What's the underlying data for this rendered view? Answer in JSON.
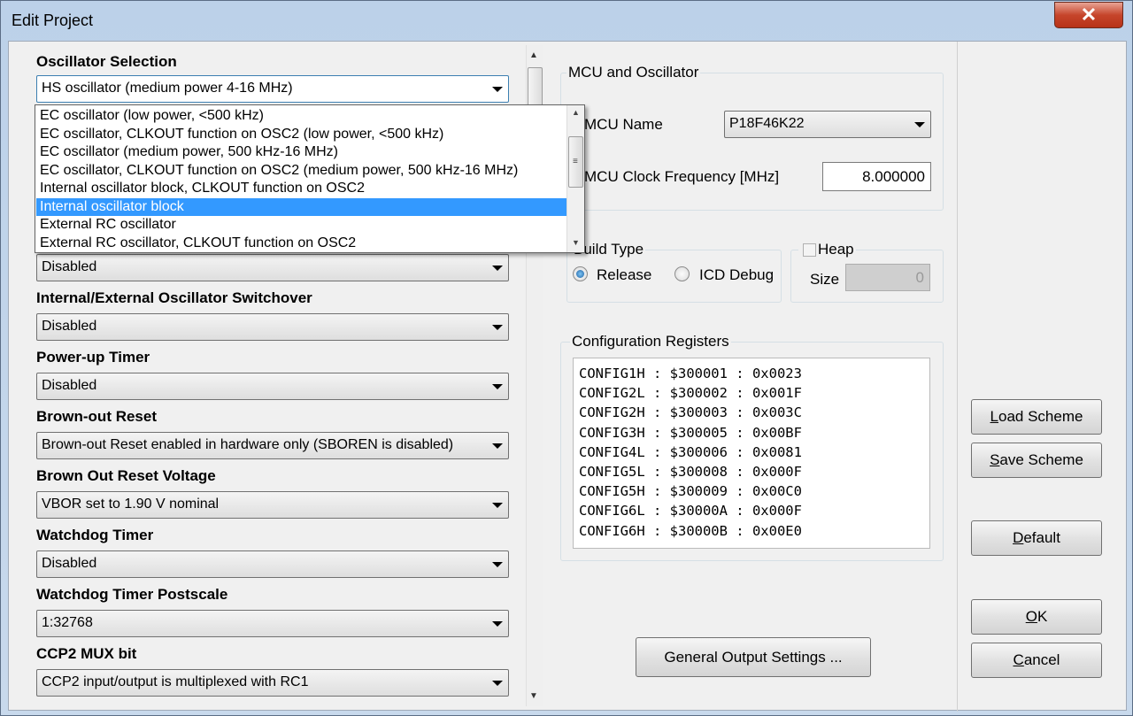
{
  "window": {
    "title": "Edit Project",
    "close_glyph": "✕"
  },
  "left": {
    "groups": [
      {
        "label": "Oscillator Selection",
        "value": "HS oscillator (medium power 4-16 MHz)"
      },
      {
        "label": "",
        "value": "Disabled"
      },
      {
        "label": "Internal/External Oscillator Switchover",
        "value": "Disabled"
      },
      {
        "label": "Power-up Timer",
        "value": "Disabled"
      },
      {
        "label": "Brown-out Reset",
        "value": "Brown-out Reset enabled in hardware only (SBOREN is disabled)"
      },
      {
        "label": "Brown Out Reset Voltage",
        "value": "VBOR set to 1.90 V nominal"
      },
      {
        "label": "Watchdog Timer",
        "value": "Disabled"
      },
      {
        "label": "Watchdog Timer Postscale",
        "value": "1:32768"
      },
      {
        "label": "CCP2 MUX bit",
        "value": "CCP2 input/output is multiplexed with RC1"
      }
    ],
    "dropdown_options": [
      "EC oscillator (low power, <500 kHz)",
      "EC oscillator, CLKOUT function on OSC2 (low power, <500 kHz)",
      "EC oscillator (medium power, 500 kHz-16 MHz)",
      "EC oscillator, CLKOUT function on OSC2 (medium power, 500 kHz-16 MHz)",
      "Internal oscillator block, CLKOUT function on OSC2",
      "Internal oscillator block",
      "External RC oscillator",
      "External RC oscillator, CLKOUT function on OSC2"
    ],
    "dropdown_selected_index": 5
  },
  "mcu": {
    "legend": "MCU and Oscillator",
    "name_label": "MCU Name",
    "name_value": "P18F46K22",
    "freq_label": "MCU Clock Frequency [MHz]",
    "freq_value": "8.000000"
  },
  "build": {
    "legend": "Build Type",
    "release_label": "Release",
    "icd_label": "ICD Debug",
    "selected": "Release"
  },
  "heap": {
    "legend": "Heap",
    "size_label": "Size",
    "size_value": "0",
    "checked": false
  },
  "config": {
    "legend": "Configuration Registers",
    "rows": [
      "CONFIG1H : $300001 : 0x0023",
      "CONFIG2L : $300002 : 0x001F",
      "CONFIG2H : $300003 : 0x003C",
      "CONFIG3H : $300005 : 0x00BF",
      "CONFIG4L : $300006 : 0x0081",
      "CONFIG5L : $300008 : 0x000F",
      "CONFIG5H : $300009 : 0x00C0",
      "CONFIG6L : $30000A : 0x000F",
      "CONFIG6H : $30000B : 0x00E0"
    ]
  },
  "buttons": {
    "general_output": "General Output Settings ...",
    "load_scheme_pre": "L",
    "load_scheme_rest": "oad Scheme",
    "save_scheme_pre": "S",
    "save_scheme_rest": "ave Scheme",
    "default_pre": "D",
    "default_rest": "efault",
    "ok_pre": "O",
    "ok_rest": "K",
    "cancel_pre": "C",
    "cancel_rest": "ancel"
  }
}
